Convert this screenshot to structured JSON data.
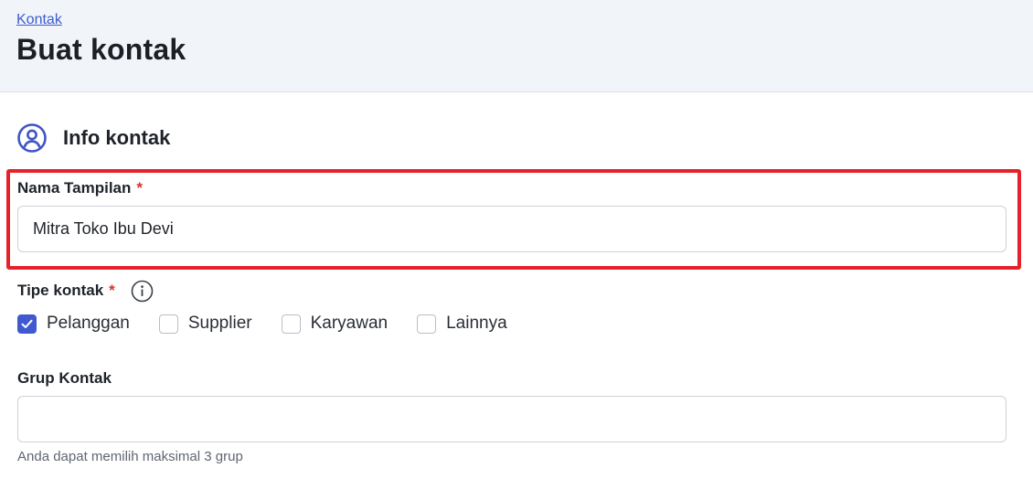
{
  "breadcrumb": {
    "label": "Kontak"
  },
  "page": {
    "title": "Buat kontak"
  },
  "section": {
    "title": "Info kontak",
    "icon": "user-circle-icon"
  },
  "display_name": {
    "label": "Nama Tampilan",
    "required_mark": "*",
    "value": "Mitra Toko Ibu Devi"
  },
  "contact_type": {
    "label": "Tipe kontak",
    "required_mark": "*",
    "info_icon": "info-icon",
    "options": [
      {
        "label": "Pelanggan",
        "checked": true
      },
      {
        "label": "Supplier",
        "checked": false
      },
      {
        "label": "Karyawan",
        "checked": false
      },
      {
        "label": "Lainnya",
        "checked": false
      }
    ]
  },
  "contact_group": {
    "label": "Grup Kontak",
    "value": "",
    "helper": "Anda dapat memilih maksimal 3 grup"
  },
  "colors": {
    "accent": "#4059d0",
    "highlight": "#e5222a",
    "required": "#d8322f",
    "link": "#3c5ccf"
  }
}
